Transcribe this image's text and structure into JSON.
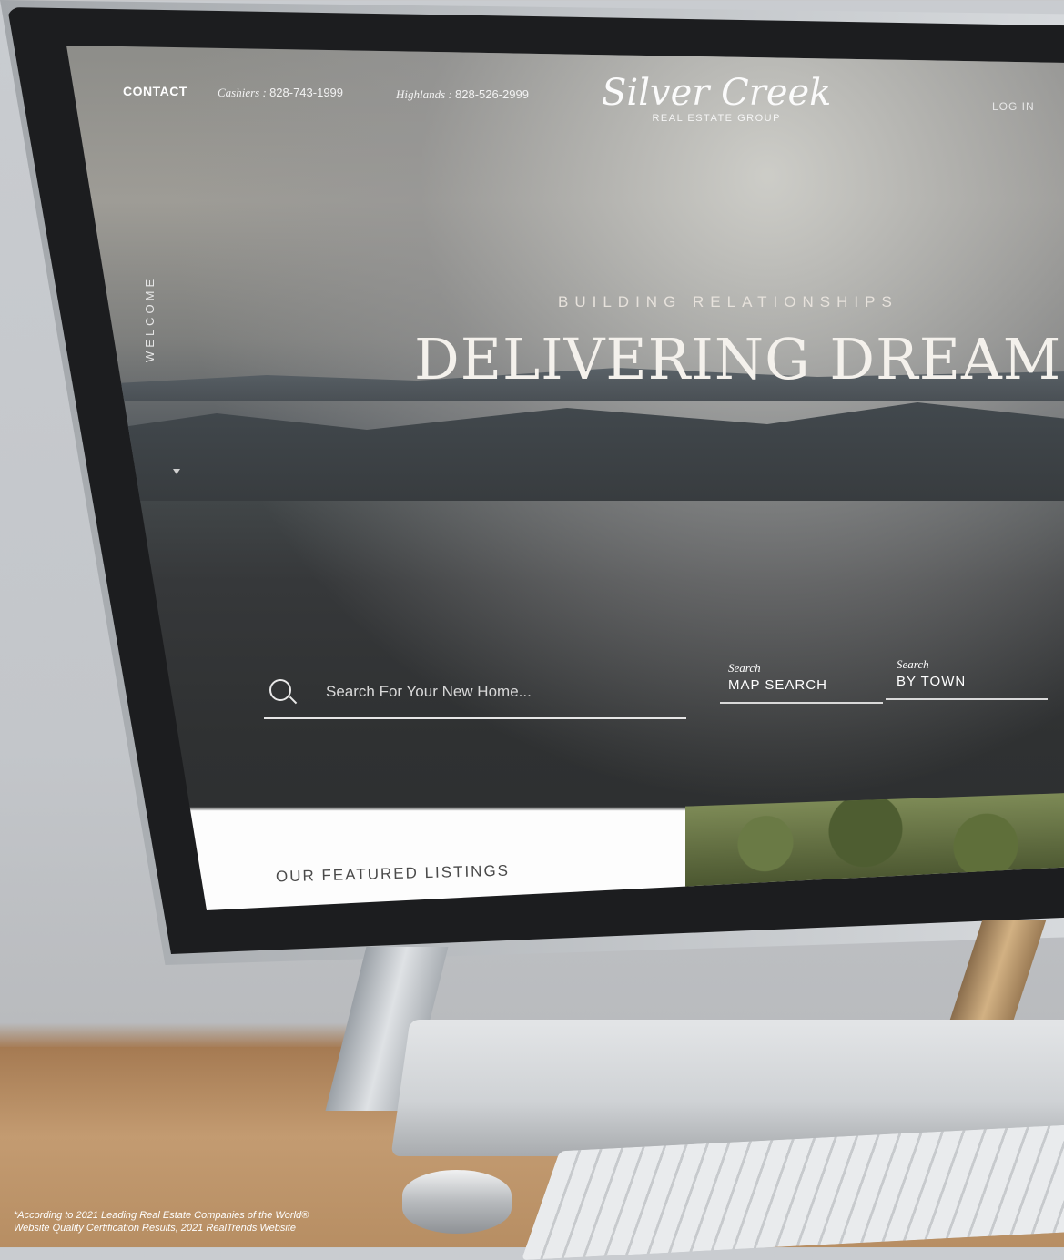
{
  "header": {
    "contact_label": "CONTACT",
    "cashiers_label": "Cashiers :",
    "cashiers_phone": "828-743-1999",
    "highlands_label": "Highlands :",
    "highlands_phone": "828-526-2999",
    "logo_main": "Silver Creek",
    "logo_sub": "REAL ESTATE GROUP",
    "login_label": "LOG IN"
  },
  "hero": {
    "side_label": "WELCOME",
    "kicker": "BUILDING RELATIONSHIPS",
    "headline": "DELIVERING DREAMS"
  },
  "search": {
    "placeholder": "Search For Your New Home...",
    "icon": "search-icon",
    "tabs": [
      {
        "small": "Search",
        "main": "MAP SEARCH"
      },
      {
        "small": "Search",
        "main": "BY TOWN"
      }
    ]
  },
  "featured": {
    "title": "OUR FEATURED LISTINGS"
  },
  "footnote": {
    "line1": "*According to 2021 Leading Real Estate Companies of the World®",
    "line2": "Website Quality Certification Results, 2021  RealTrends Website"
  }
}
